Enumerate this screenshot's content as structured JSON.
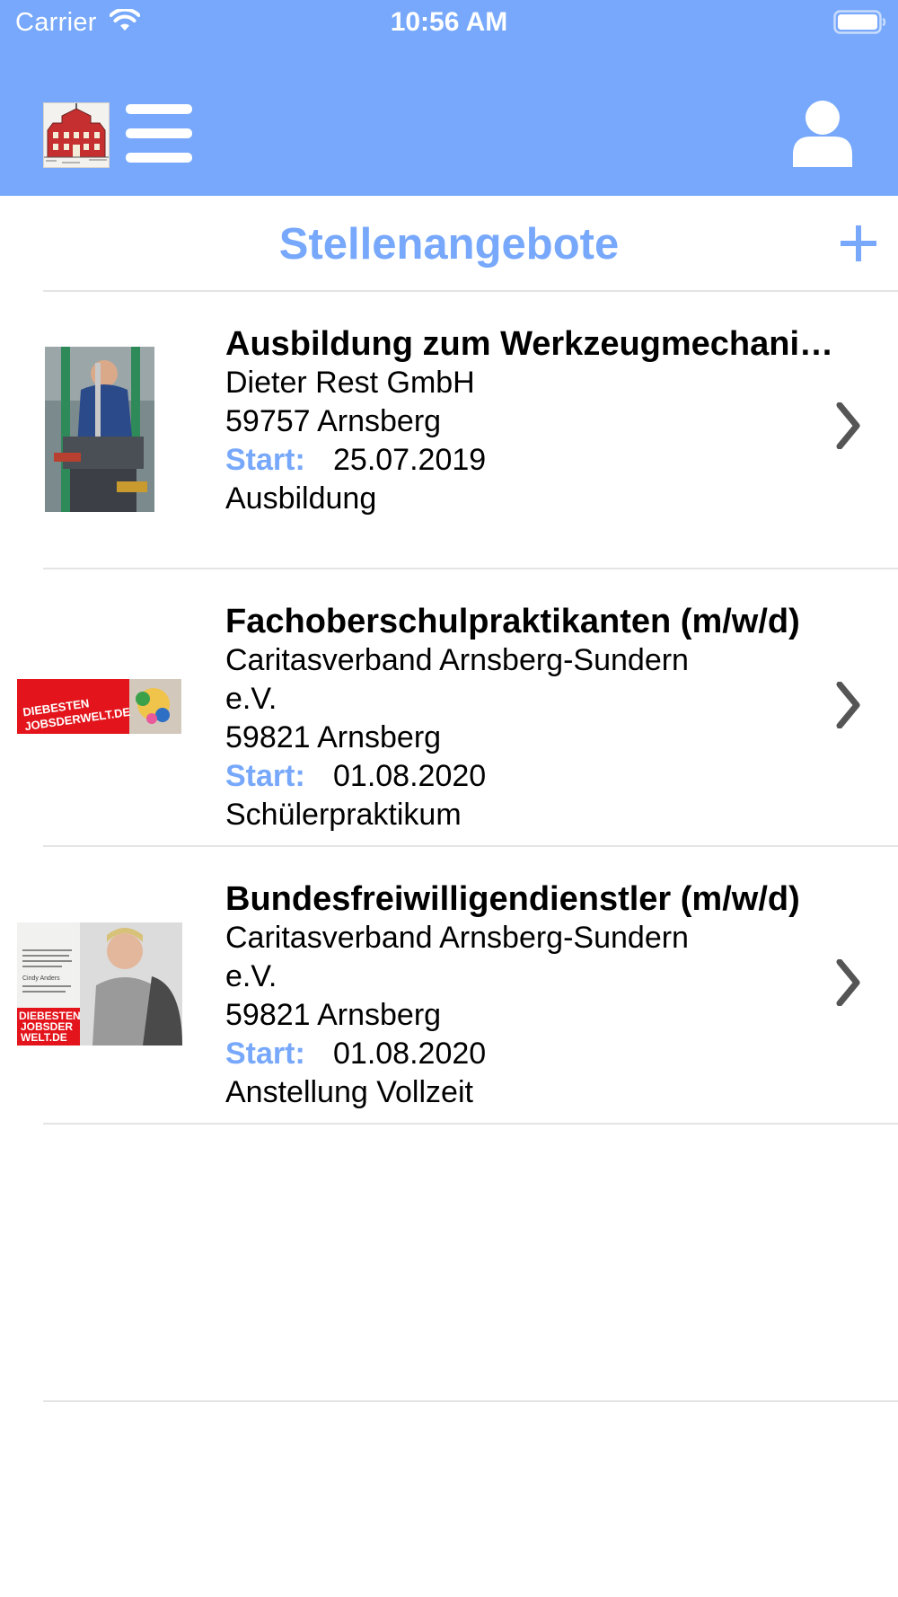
{
  "status_bar": {
    "carrier": "Carrier",
    "time": "10:56 AM"
  },
  "header": {
    "menu_icon": "hamburger-menu-icon",
    "user_icon": "user-profile-icon",
    "logo": "town-hall-logo"
  },
  "page": {
    "title": "Stellenangebote",
    "add_icon": "plus-icon"
  },
  "colors": {
    "accent": "#77a8fb",
    "divider": "#e4e4e4",
    "chevron": "#555555"
  },
  "jobs": [
    {
      "title": "Ausbildung zum Werkzeugmechani…",
      "company": "Dieter Rest GmbH",
      "location": "59757 Arnsberg",
      "start_label": "Start:",
      "start_date": "25.07.2019",
      "type": "Ausbildung"
    },
    {
      "title": "Fachoberschulpraktikanten (m/w/d)",
      "company": "Caritasverband Arnsberg-Sundern e.V.",
      "location": "59821 Arnsberg",
      "start_label": "Start:",
      "start_date": "01.08.2020",
      "type": "Schülerpraktikum",
      "thumb_text": [
        "DIEBESTEN",
        "JOBSDERWELT.DE"
      ]
    },
    {
      "title": "Bundesfreiwilligendienstler (m/w/d)",
      "company": "Caritasverband Arnsberg-Sundern e.V.",
      "location": "59821 Arnsberg",
      "start_label": "Start:",
      "start_date": "01.08.2020",
      "type": "Anstellung Vollzeit",
      "thumb_text": [
        "DIEBESTEN",
        "JOBSDER",
        "WELT.DE",
        "Cindy Anders"
      ]
    }
  ]
}
